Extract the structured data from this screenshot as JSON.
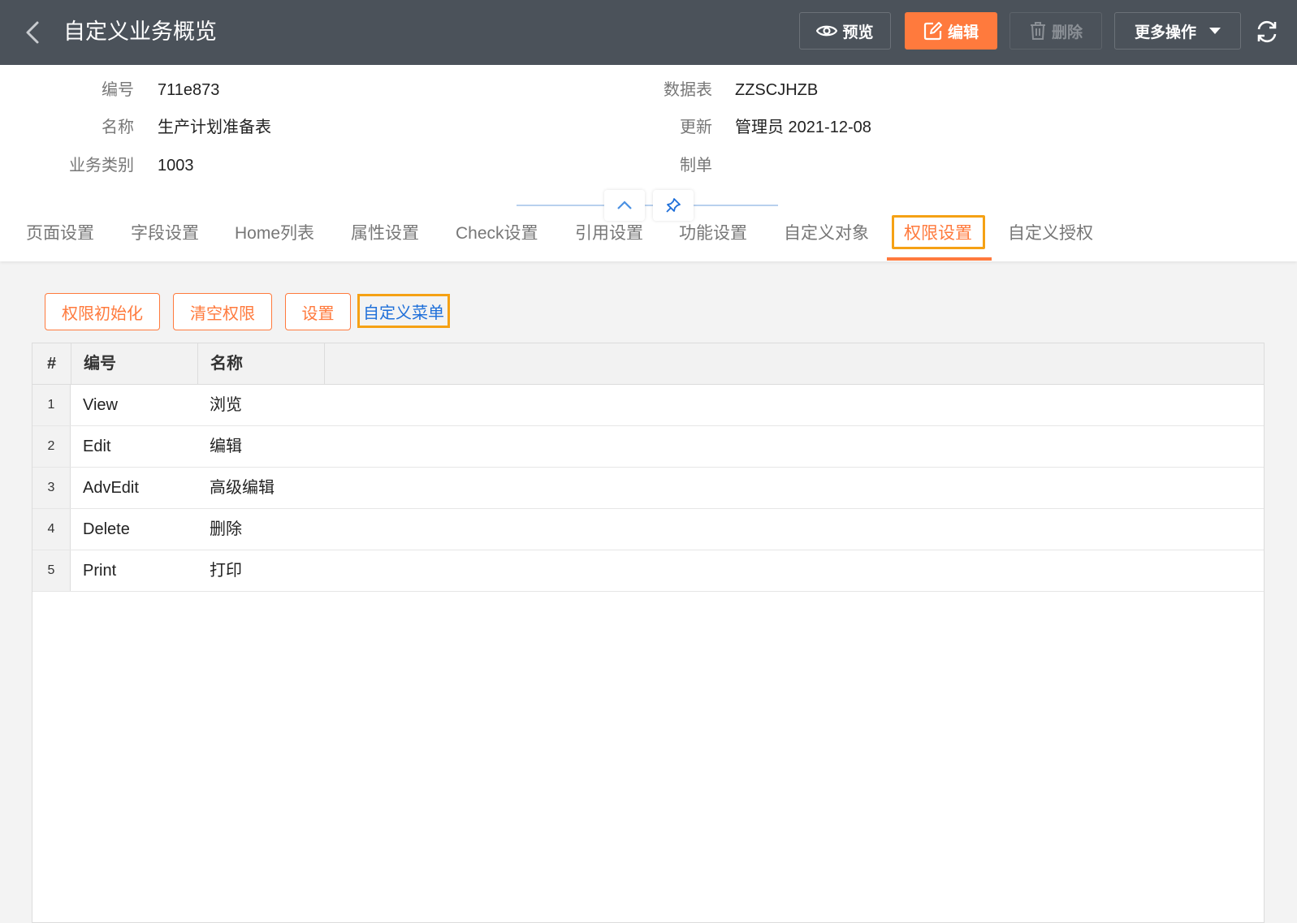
{
  "header": {
    "title": "自定义业务概览",
    "buttons": {
      "preview": "预览",
      "edit": "编辑",
      "delete": "删除",
      "more": "更多操作"
    }
  },
  "info": {
    "code_label": "编号",
    "code_value": "711e873",
    "name_label": "名称",
    "name_value": "生产计划准备表",
    "category_label": "业务类别",
    "category_value": "1003",
    "table_label": "数据表",
    "table_value": "ZZSCJHZB",
    "updated_label": "更新",
    "updated_value": "管理员 2021-12-08",
    "creator_label": "制单",
    "creator_value": ""
  },
  "tabs": [
    {
      "label": "页面设置"
    },
    {
      "label": "字段设置"
    },
    {
      "label": "Home列表"
    },
    {
      "label": "属性设置"
    },
    {
      "label": "Check设置"
    },
    {
      "label": "引用设置"
    },
    {
      "label": "功能设置"
    },
    {
      "label": "自定义对象"
    },
    {
      "label": "权限设置"
    },
    {
      "label": "自定义授权"
    }
  ],
  "active_tab": "权限设置",
  "actions": {
    "init": "权限初始化",
    "clear": "清空权限",
    "settings": "设置",
    "custom_menu": "自定义菜单"
  },
  "table": {
    "headers": {
      "index": "#",
      "code": "编号",
      "name": "名称"
    },
    "rows": [
      {
        "index": "1",
        "code": "View",
        "name": "浏览"
      },
      {
        "index": "2",
        "code": "Edit",
        "name": "编辑"
      },
      {
        "index": "3",
        "code": "AdvEdit",
        "name": "高级编辑"
      },
      {
        "index": "4",
        "code": "Delete",
        "name": "删除"
      },
      {
        "index": "5",
        "code": "Print",
        "name": "打印"
      }
    ]
  },
  "colors": {
    "header_bg": "#4b525a",
    "accent": "#ff7a3d",
    "highlight_box": "#f5a114",
    "link": "#1e6fd9"
  },
  "icons": {
    "back": "chevron-left-icon",
    "preview": "eye-icon",
    "edit": "edit-icon",
    "delete": "trash-icon",
    "more": "caret-down-icon",
    "refresh": "refresh-icon",
    "collapse": "chevron-up-icon",
    "pin": "pin-icon"
  }
}
